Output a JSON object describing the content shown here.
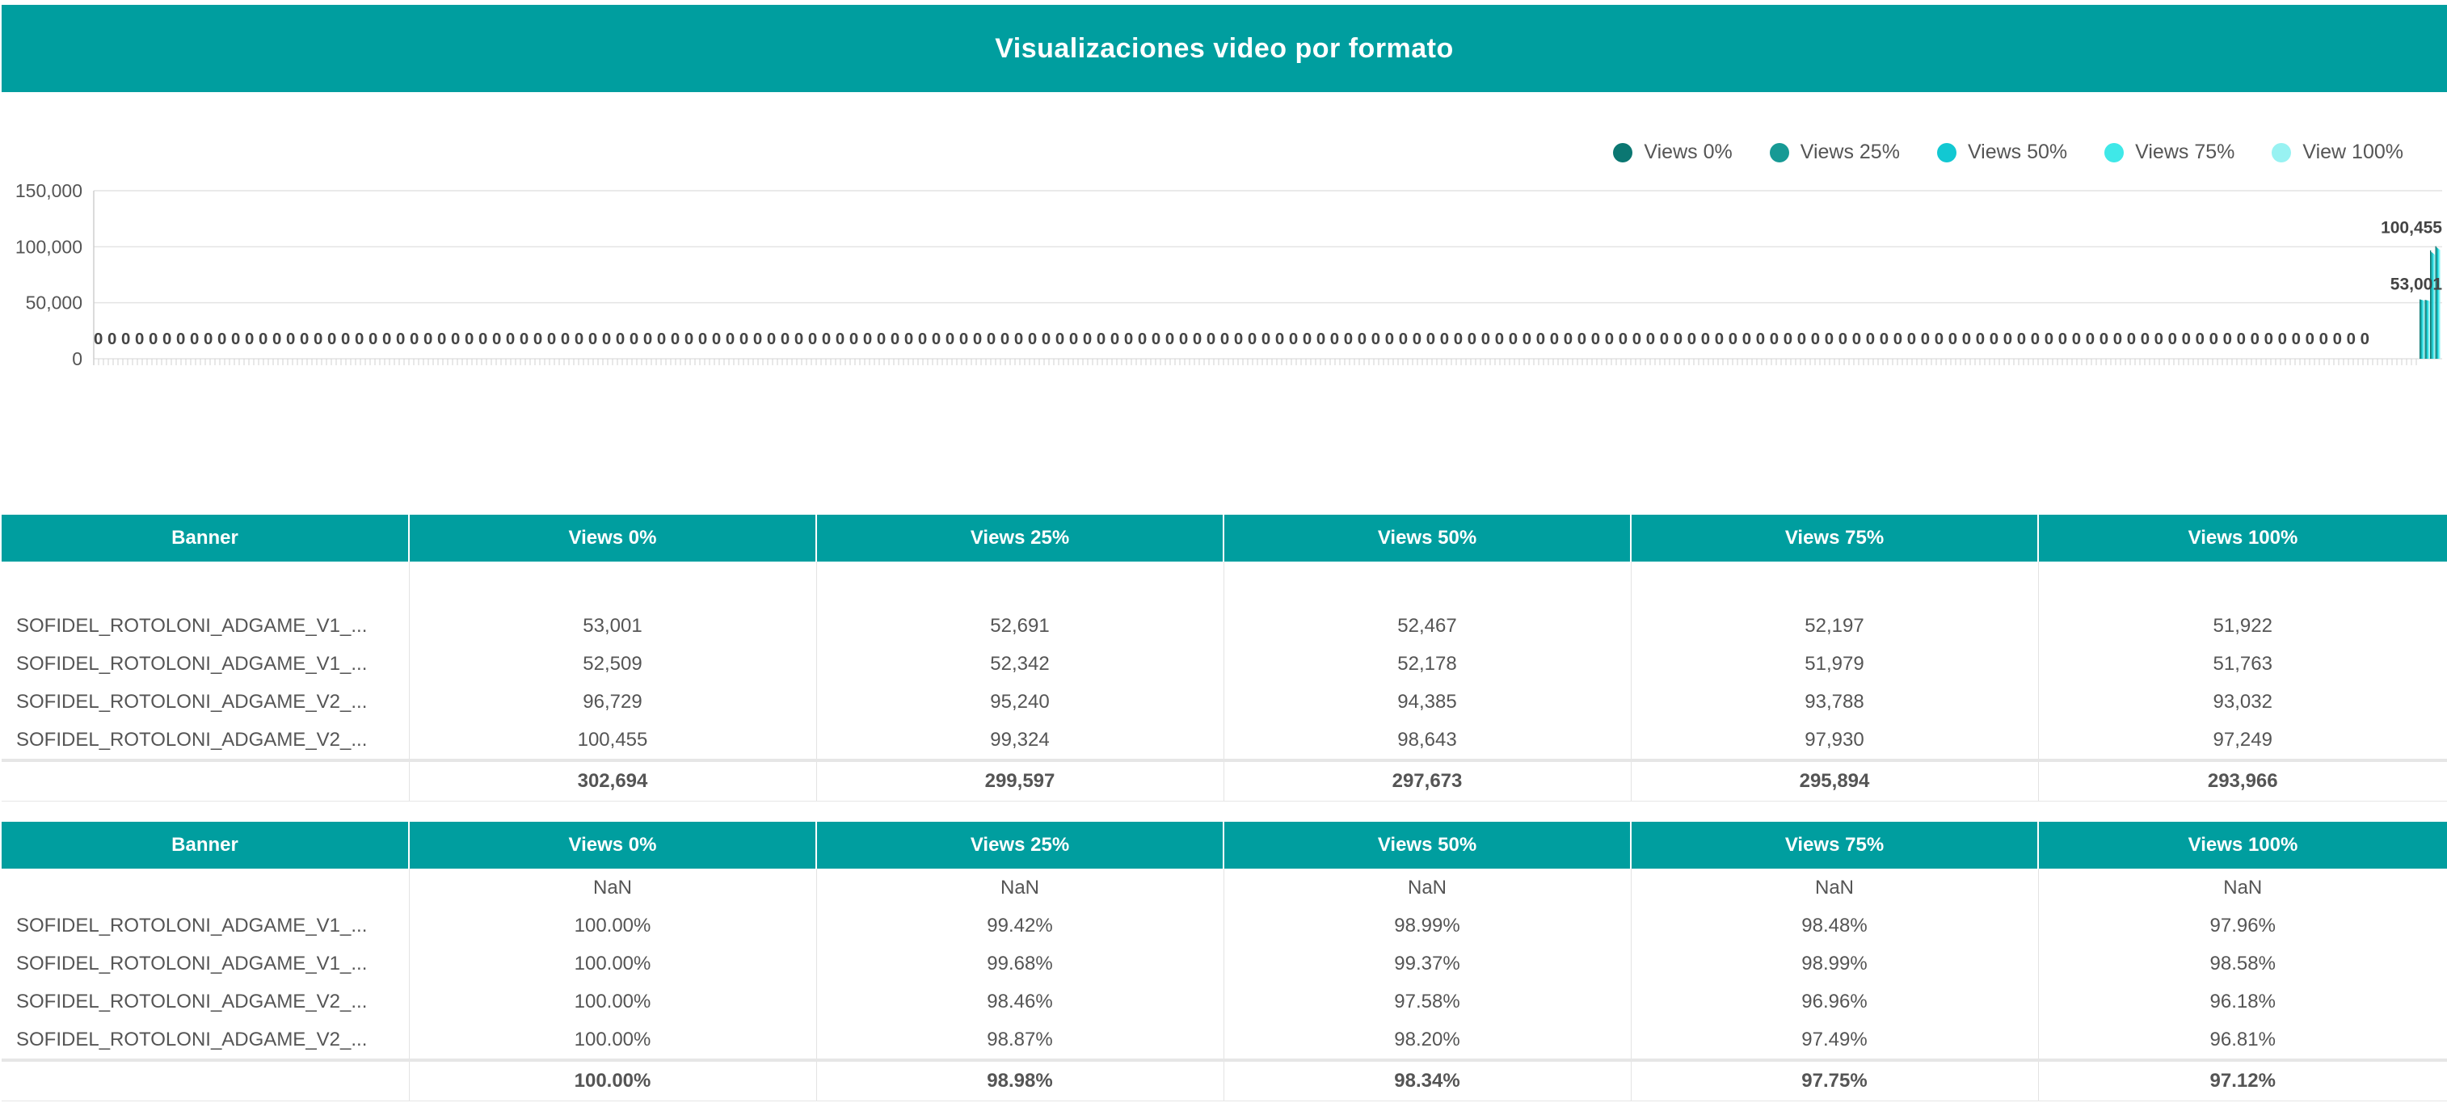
{
  "header": {
    "title": "Visualizaciones video por formato"
  },
  "colors": {
    "brand": "#009e9f",
    "series": [
      "#0b7772",
      "#179a95",
      "#12c8d2",
      "#3fe8e8",
      "#98f2f2"
    ]
  },
  "legend": [
    "Views 0%",
    "Views 25%",
    "Views 50%",
    "Views 75%",
    "View 100%"
  ],
  "chart_data": {
    "type": "bar",
    "yticks": [
      "150,000",
      "100,000",
      "50,000",
      "0"
    ],
    "ylim": [
      0,
      150000
    ],
    "series": [
      {
        "name": "Views 0%",
        "values": [
          53001,
          52509,
          96729,
          100455
        ]
      },
      {
        "name": "Views 25%",
        "values": [
          52691,
          52342,
          95240,
          99324
        ]
      },
      {
        "name": "Views 50%",
        "values": [
          52467,
          52178,
          94385,
          98643
        ]
      },
      {
        "name": "Views 75%",
        "values": [
          52197,
          51979,
          93788,
          97930
        ]
      },
      {
        "name": "View 100%",
        "values": [
          51922,
          51763,
          93032,
          97249
        ]
      }
    ],
    "zero_labels_count": 166,
    "data_labels": [
      "53,001",
      "100,455"
    ]
  },
  "table1": {
    "headers": [
      "Banner",
      "Views 0%",
      "Views 25%",
      "Views 50%",
      "Views 75%",
      "Views 100%"
    ],
    "rows": [
      [
        "SOFIDEL_ROTOLONI_ADGAME_V1_...",
        "53,001",
        "52,691",
        "52,467",
        "52,197",
        "51,922"
      ],
      [
        "SOFIDEL_ROTOLONI_ADGAME_V1_...",
        "52,509",
        "52,342",
        "52,178",
        "51,979",
        "51,763"
      ],
      [
        "SOFIDEL_ROTOLONI_ADGAME_V2_...",
        "96,729",
        "95,240",
        "94,385",
        "93,788",
        "93,032"
      ],
      [
        "SOFIDEL_ROTOLONI_ADGAME_V2_...",
        "100,455",
        "99,324",
        "98,643",
        "97,930",
        "97,249"
      ]
    ],
    "total": [
      "",
      "302,694",
      "299,597",
      "297,673",
      "295,894",
      "293,966"
    ]
  },
  "table2": {
    "headers": [
      "Banner",
      "Views 0%",
      "Views 25%",
      "Views 50%",
      "Views 75%",
      "Views 100%"
    ],
    "nan_row": [
      "",
      "NaN",
      "NaN",
      "NaN",
      "NaN",
      "NaN"
    ],
    "rows": [
      [
        "SOFIDEL_ROTOLONI_ADGAME_V1_...",
        "100.00%",
        "99.42%",
        "98.99%",
        "98.48%",
        "97.96%"
      ],
      [
        "SOFIDEL_ROTOLONI_ADGAME_V1_...",
        "100.00%",
        "99.68%",
        "99.37%",
        "98.99%",
        "98.58%"
      ],
      [
        "SOFIDEL_ROTOLONI_ADGAME_V2_...",
        "100.00%",
        "98.46%",
        "97.58%",
        "96.96%",
        "96.18%"
      ],
      [
        "SOFIDEL_ROTOLONI_ADGAME_V2_...",
        "100.00%",
        "98.87%",
        "98.20%",
        "97.49%",
        "96.81%"
      ]
    ],
    "total": [
      "",
      "100.00%",
      "98.98%",
      "98.34%",
      "97.75%",
      "97.12%"
    ]
  }
}
